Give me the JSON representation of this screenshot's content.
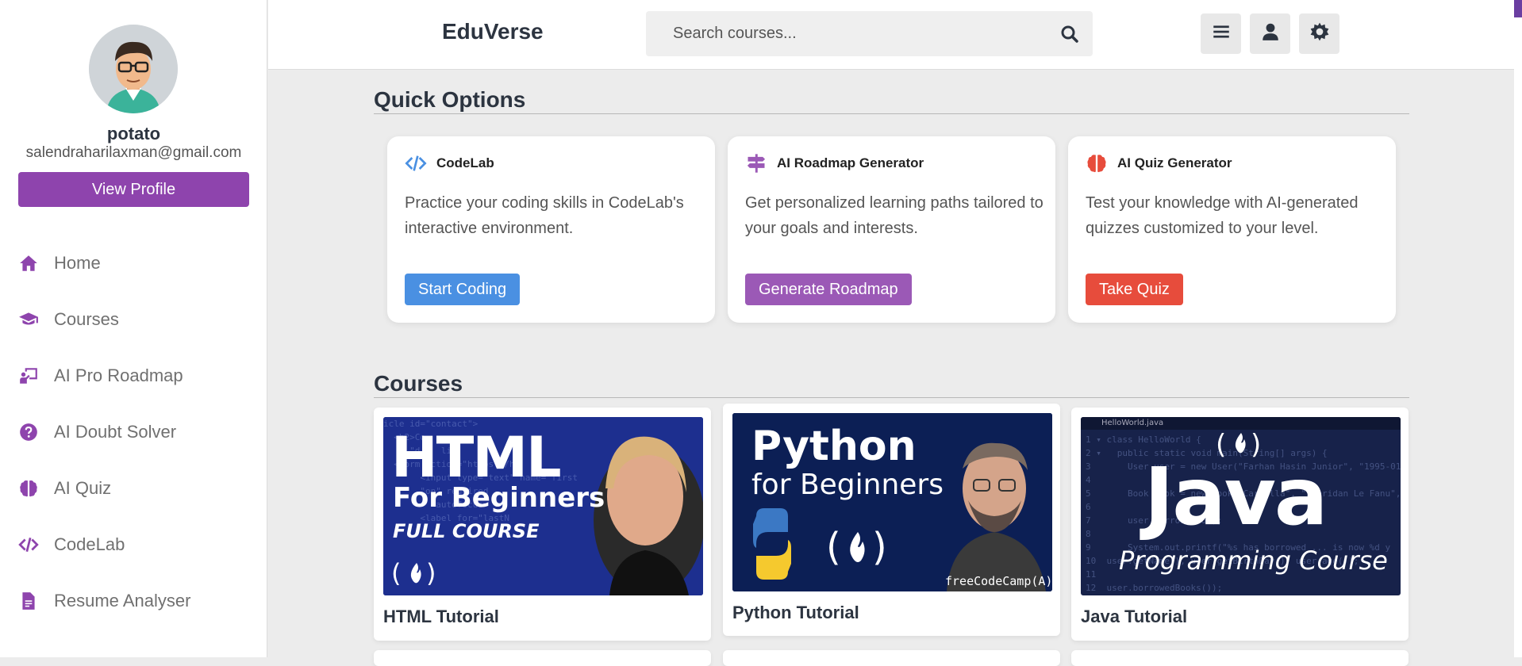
{
  "user": {
    "name": "potato",
    "email": "salendraharilaxman@gmail.com",
    "view_profile_label": "View Profile"
  },
  "sidebar": {
    "items": [
      {
        "label": "Home",
        "icon": "home-icon"
      },
      {
        "label": "Courses",
        "icon": "graduation-cap-icon"
      },
      {
        "label": "AI Pro Roadmap",
        "icon": "chalkboard-teacher-icon"
      },
      {
        "label": "AI Doubt Solver",
        "icon": "question-circle-icon"
      },
      {
        "label": "AI Quiz",
        "icon": "brain-icon"
      },
      {
        "label": "CodeLab",
        "icon": "code-icon"
      },
      {
        "label": "Resume Analyser",
        "icon": "file-icon"
      }
    ]
  },
  "header": {
    "brand": "EduVerse",
    "search_placeholder": "Search courses...",
    "buttons": [
      "menu-icon",
      "user-icon",
      "theme-gear-icon"
    ]
  },
  "quick_options": {
    "title": "Quick Options",
    "cards": [
      {
        "title": "CodeLab",
        "icon": "code-icon",
        "description": "Practice your coding skills in CodeLab's interactive environment.",
        "button": "Start Coding",
        "color": "#4a90e2"
      },
      {
        "title": "AI Roadmap Generator",
        "icon": "signpost-icon",
        "description": "Get personalized learning paths tailored to your goals and interests.",
        "button": "Generate Roadmap",
        "color": "#9b59b6"
      },
      {
        "title": "AI Quiz Generator",
        "icon": "brain-icon",
        "description": "Test your knowledge with AI-generated quizzes customized to your level.",
        "button": "Take Quiz",
        "color": "#e74c3c"
      }
    ]
  },
  "courses": {
    "title": "Courses",
    "items": [
      {
        "title": "HTML Tutorial",
        "thumb_line1": "HTML",
        "thumb_line2": "For Beginners",
        "thumb_line3": "FULL COURSE"
      },
      {
        "title": "Python Tutorial",
        "thumb_line1": "Python",
        "thumb_line2": "for Beginners",
        "thumb_watermark": "freeCodeCamp(A)"
      },
      {
        "title": "Java Tutorial",
        "thumb_line1": "Java",
        "thumb_line2": "Programming Course",
        "thumb_tab": "HelloWorld.java"
      }
    ]
  },
  "colors": {
    "accent": "#8e44ad",
    "text_dark": "#2c3440"
  }
}
